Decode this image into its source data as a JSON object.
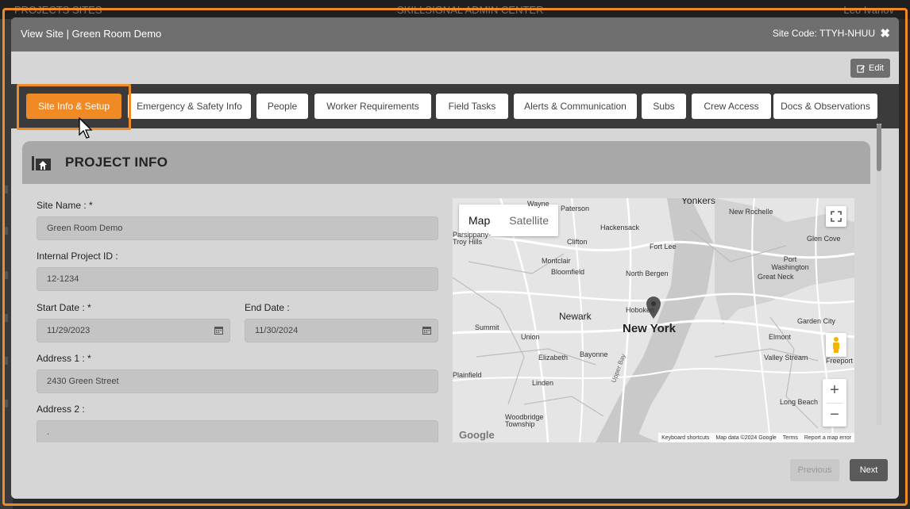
{
  "background": {
    "left_text": "PROJECTS SITES",
    "center_text": "SKILLSIGNAL ADMIN CENTER",
    "right_text": "Leo Ivanov"
  },
  "modal": {
    "title": "View Site | Green Room Demo",
    "site_code": "Site Code: TTYH-NHUU",
    "close_icon": "close-icon",
    "edit_label": "Edit"
  },
  "tabs": [
    {
      "label": "Site Info & Setup",
      "active": true
    },
    {
      "label": "Emergency & Safety Info",
      "active": false
    },
    {
      "label": "People",
      "active": false
    },
    {
      "label": "Worker Requirements",
      "active": false
    },
    {
      "label": "Field Tasks",
      "active": false
    },
    {
      "label": "Alerts & Communication",
      "active": false
    },
    {
      "label": "Subs",
      "active": false
    },
    {
      "label": "Crew Access",
      "active": false
    },
    {
      "label": "Docs & Observations",
      "active": false
    }
  ],
  "section": {
    "title": "PROJECT INFO",
    "icon": "building-icon"
  },
  "form": {
    "site_name_label": "Site Name : *",
    "site_name_value": "Green Room Demo",
    "internal_id_label": "Internal Project ID :",
    "internal_id_value": "12-1234",
    "start_date_label": "Start Date : *",
    "start_date_value": "11/29/2023",
    "end_date_label": "End Date :",
    "end_date_value": "11/30/2024",
    "address1_label": "Address 1 : *",
    "address1_value": "2430 Green Street",
    "address2_label": "Address 2 :",
    "address2_value": "."
  },
  "map": {
    "map_label": "Map",
    "satellite_label": "Satellite",
    "places": {
      "new_york": "New York",
      "newark": "Newark",
      "hoboken": "Hoboken",
      "yonkers": "Yonkers",
      "new_rochelle": "New Rochelle",
      "hackensack": "Hackensack",
      "paterson": "Paterson",
      "wayne": "Wayne",
      "clifton": "Clifton",
      "montclair": "Montclair",
      "bloomfield": "Bloomfield",
      "north_bergen": "North Bergen",
      "fort_lee": "Fort Lee",
      "glen_cove": "Glen Cove",
      "port_washington": "Port Washington",
      "great_neck": "Great Neck",
      "garden_city": "Garden City",
      "elmont": "Elmont",
      "valley_stream": "Valley Stream",
      "freeport": "Freeport",
      "summit": "Summit",
      "union": "Union",
      "elizabeth": "Elizabeth",
      "bayonne": "Bayonne",
      "linden": "Linden",
      "plainfield": "Plainfield",
      "woodbridge": "Woodbridge Township",
      "long_beach": "Long Beach",
      "parsippany": "Parsippany-Troy Hills",
      "upper_bay": "Upper Bay"
    },
    "footer": {
      "shortcuts": "Keyboard shortcuts",
      "data": "Map data ©2024 Google",
      "terms": "Terms",
      "report": "Report a map error"
    },
    "google_text": "Google"
  },
  "footer": {
    "previous_label": "Previous",
    "next_label": "Next"
  },
  "colors": {
    "accent": "#f08a24",
    "header": "#6f6f6f",
    "tabs_bg": "#3b3b3b"
  }
}
